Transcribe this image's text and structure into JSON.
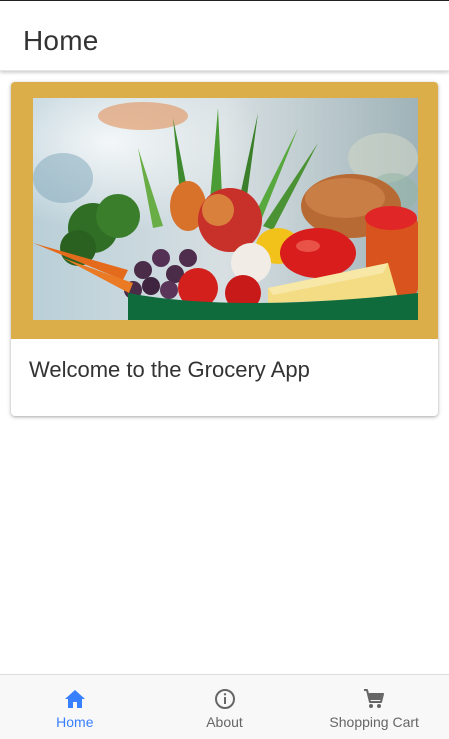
{
  "header": {
    "title": "Home"
  },
  "card": {
    "image_icon": "grocery-vegetables-image",
    "text": "Welcome to the Grocery App",
    "frame_color": "#dcae49"
  },
  "tabs": [
    {
      "label": "Home",
      "icon": "home-icon",
      "active": true
    },
    {
      "label": "About",
      "icon": "info-icon",
      "active": false
    },
    {
      "label": "Shopping Cart",
      "icon": "cart-icon",
      "active": false
    }
  ],
  "colors": {
    "accent": "#3880ff",
    "inactive": "#666666"
  }
}
